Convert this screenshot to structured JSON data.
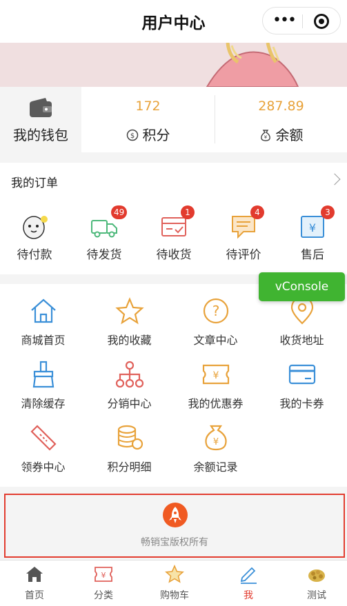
{
  "header": {
    "title": "用户中心"
  },
  "capsule": {
    "more_icon": "more-dots-icon",
    "close_icon": "target-close-icon"
  },
  "wallet": {
    "label": "我的钱包",
    "points": {
      "value": "172",
      "label": "积分"
    },
    "balance": {
      "value": "287.89",
      "label": "余额"
    }
  },
  "orders": {
    "title": "我的订单",
    "items": [
      {
        "label": "待付款",
        "icon": "penguin-icon",
        "badge": ""
      },
      {
        "label": "待发货",
        "icon": "truck-icon",
        "badge": "49"
      },
      {
        "label": "待收货",
        "icon": "box-icon",
        "badge": "1"
      },
      {
        "label": "待评价",
        "icon": "comment-icon",
        "badge": "4"
      },
      {
        "label": "售后",
        "icon": "refund-icon",
        "badge": "3"
      }
    ]
  },
  "grid": {
    "items": [
      {
        "label": "商城首页",
        "icon": "house-icon"
      },
      {
        "label": "我的收藏",
        "icon": "star-icon"
      },
      {
        "label": "文章中心",
        "icon": "question-icon"
      },
      {
        "label": "收货地址",
        "icon": "location-icon"
      },
      {
        "label": "清除缓存",
        "icon": "broom-icon"
      },
      {
        "label": "分销中心",
        "icon": "network-icon"
      },
      {
        "label": "我的优惠券",
        "icon": "ticket-icon"
      },
      {
        "label": "我的卡券",
        "icon": "card-icon"
      },
      {
        "label": "领券中心",
        "icon": "coupon-icon"
      },
      {
        "label": "积分明细",
        "icon": "coins-icon"
      },
      {
        "label": "余额记录",
        "icon": "money-bag-icon"
      }
    ]
  },
  "vconsole": {
    "label": "vConsole"
  },
  "brand": {
    "text": "畅销宝版权所有"
  },
  "tabs": [
    {
      "label": "首页",
      "icon": "home-icon"
    },
    {
      "label": "分类",
      "icon": "category-icon"
    },
    {
      "label": "购物车",
      "icon": "cart-star-icon"
    },
    {
      "label": "我",
      "icon": "pen-icon",
      "active": true
    },
    {
      "label": "测试",
      "icon": "food-icon"
    }
  ],
  "colors": {
    "accent": "#e23b2e",
    "gold": "#e8a23a",
    "blue": "#3a8fd8",
    "green": "#40b431"
  }
}
